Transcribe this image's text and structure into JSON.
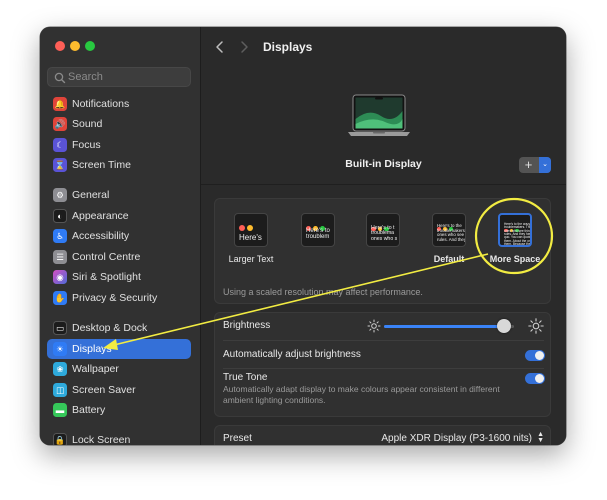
{
  "search": {
    "placeholder": "Search"
  },
  "sidebar": {
    "items": [
      {
        "label": "Notifications",
        "icon": "bell-icon",
        "color": "#e0443a",
        "glyph": "🔔"
      },
      {
        "label": "Sound",
        "icon": "speaker-icon",
        "color": "#e0443a",
        "glyph": "🔊"
      },
      {
        "label": "Focus",
        "icon": "moon-icon",
        "color": "#5a53d6",
        "glyph": "☾"
      },
      {
        "label": "Screen Time",
        "icon": "hourglass-icon",
        "color": "#5a53d6",
        "glyph": "⌛"
      },
      {
        "label": "General",
        "icon": "gear-icon",
        "color": "#8e8e93",
        "glyph": "⚙"
      },
      {
        "label": "Appearance",
        "icon": "appearance-icon",
        "color": "#1c1c1c",
        "glyph": "◐"
      },
      {
        "label": "Accessibility",
        "icon": "accessibility-icon",
        "color": "#2f7bf5",
        "glyph": "♿"
      },
      {
        "label": "Control Centre",
        "icon": "control-centre-icon",
        "color": "#8e8e93",
        "glyph": "☰"
      },
      {
        "label": "Siri & Spotlight",
        "icon": "siri-icon",
        "color": "#b04fd8",
        "glyph": "◉"
      },
      {
        "label": "Privacy & Security",
        "icon": "hand-icon",
        "color": "#2f7bf5",
        "glyph": "✋"
      },
      {
        "label": "Desktop & Dock",
        "icon": "dock-icon",
        "color": "#1c1c1c",
        "glyph": "▭"
      },
      {
        "label": "Displays",
        "icon": "sun-icon",
        "color": "#2f7bf5",
        "glyph": "☀"
      },
      {
        "label": "Wallpaper",
        "icon": "wallpaper-icon",
        "color": "#2eaadc",
        "glyph": "❀"
      },
      {
        "label": "Screen Saver",
        "icon": "screen-saver-icon",
        "color": "#2eaadc",
        "glyph": "◫"
      },
      {
        "label": "Battery",
        "icon": "battery-icon",
        "color": "#35c759",
        "glyph": "▬"
      },
      {
        "label": "Lock Screen",
        "icon": "lock-icon",
        "color": "#1c1c1c",
        "glyph": "🔒"
      }
    ]
  },
  "header": {
    "title": "Displays"
  },
  "display": {
    "name": "Built-in Display",
    "add_label": "+",
    "chevron": "⌄"
  },
  "resolution": {
    "options": [
      {
        "label": "Larger Text",
        "thumb_text": "Here's"
      },
      {
        "label": "",
        "thumb_text": "Here's to\ntroublem"
      },
      {
        "label": "",
        "thumb_text": "Here's to t\ntroublema\nones who s"
      },
      {
        "label": "Default",
        "thumb_text": "Here's to the\ntroublemakers.\nones who see t\nrules. And they"
      },
      {
        "label": "More Space",
        "thumb_text": "Here's to the crazy one\ntroublemakers. The rou\nones who see things dif\nrules. And they have no\nquo. You can quote the\nthem. About the only th\nthem. Because they cha"
      }
    ],
    "note": "Using a scaled resolution may affect performance."
  },
  "brightness": {
    "label": "Brightness",
    "level": 0.92,
    "auto_label": "Automatically adjust brightness",
    "true_tone_label": "True Tone",
    "true_tone_desc": "Automatically adapt display to make colours appear consistent in different ambient lighting conditions."
  },
  "preset": {
    "label": "Preset",
    "value": "Apple XDR Display (P3-1600 nits)",
    "stepper": "⌃⌄"
  },
  "colors": {
    "accent": "#3470d8",
    "annotation": "#f2ec42"
  }
}
